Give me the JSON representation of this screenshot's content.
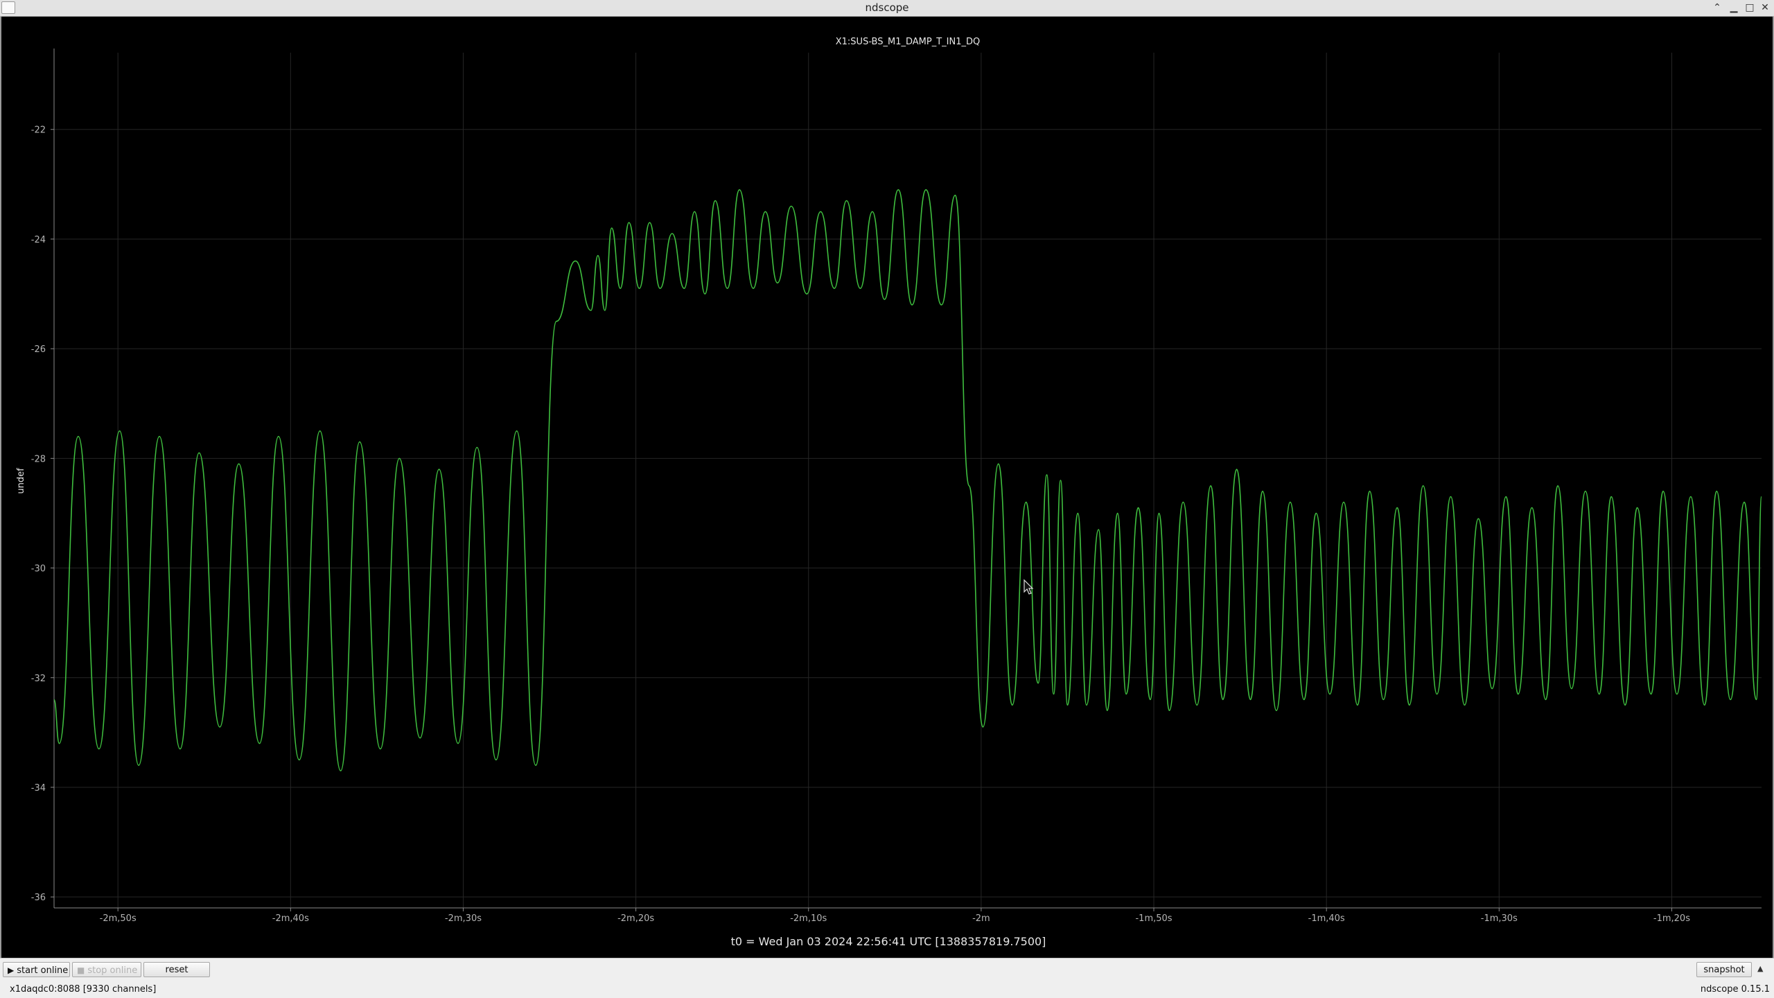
{
  "window": {
    "title": "ndscope"
  },
  "plot": {
    "channel": "X1:SUS-BS_M1_DAMP_T_IN1_DQ",
    "y_label": "undef",
    "t0_label": "t0 = Wed Jan 03 2024 22:56:41 UTC [1388357819.7500]",
    "trace_color": "#3fbf3f"
  },
  "chart_data": {
    "type": "line",
    "title": "X1:SUS-BS_M1_DAMP_T_IN1_DQ",
    "ylabel": "undef",
    "xlabel": "t0 = Wed Jan 03 2024 22:56:41 UTC [1388357819.7500]",
    "x_unit": "seconds relative to t0",
    "xlim": [
      -173.7,
      -74.8
    ],
    "ylim": [
      -36.2,
      -20.6
    ],
    "x_ticks": [
      {
        "value": -170,
        "label": "-2m,50s"
      },
      {
        "value": -160,
        "label": "-2m,40s"
      },
      {
        "value": -150,
        "label": "-2m,30s"
      },
      {
        "value": -140,
        "label": "-2m,20s"
      },
      {
        "value": -130,
        "label": "-2m,10s"
      },
      {
        "value": -120,
        "label": "-2m"
      },
      {
        "value": -110,
        "label": "-1m,50s"
      },
      {
        "value": -100,
        "label": "-1m,40s"
      },
      {
        "value": -90,
        "label": "-1m,30s"
      },
      {
        "value": -80,
        "label": "-1m,20s"
      }
    ],
    "y_ticks": [
      {
        "value": -22,
        "label": "-22"
      },
      {
        "value": -24,
        "label": "-24"
      },
      {
        "value": -26,
        "label": "-26"
      },
      {
        "value": -28,
        "label": "-28"
      },
      {
        "value": -30,
        "label": "-30"
      },
      {
        "value": -32,
        "label": "-32"
      },
      {
        "value": -34,
        "label": "-34"
      },
      {
        "value": -36,
        "label": "-36"
      }
    ],
    "grid": true,
    "series": [
      {
        "color": "#3fbf3f",
        "x": [
          -173.7,
          -173.4,
          -172.3,
          -171.1,
          -169.9,
          -168.8,
          -167.6,
          -166.4,
          -165.3,
          -164.1,
          -163.0,
          -161.8,
          -160.7,
          -159.5,
          -158.3,
          -157.1,
          -156.0,
          -154.8,
          -153.7,
          -152.5,
          -151.4,
          -150.3,
          -149.2,
          -148.1,
          -146.9,
          -145.8,
          -144.6,
          -143.5,
          -142.6,
          -142.2,
          -141.8,
          -141.4,
          -140.9,
          -140.4,
          -139.8,
          -139.2,
          -138.6,
          -137.9,
          -137.2,
          -136.6,
          -136.0,
          -135.4,
          -134.7,
          -134.0,
          -133.2,
          -132.5,
          -131.8,
          -131.0,
          -130.1,
          -129.3,
          -128.5,
          -127.8,
          -127.0,
          -126.3,
          -125.6,
          -124.8,
          -124.0,
          -123.2,
          -122.3,
          -121.5,
          -120.7,
          -119.9,
          -119.0,
          -118.2,
          -117.4,
          -116.7,
          -116.2,
          -115.8,
          -115.4,
          -115.0,
          -114.4,
          -113.9,
          -113.2,
          -112.7,
          -112.1,
          -111.6,
          -110.9,
          -110.2,
          -109.7,
          -109.1,
          -108.3,
          -107.5,
          -106.7,
          -106.0,
          -105.2,
          -104.4,
          -103.7,
          -102.9,
          -102.1,
          -101.3,
          -100.6,
          -99.8,
          -99.0,
          -98.2,
          -97.5,
          -96.7,
          -95.9,
          -95.2,
          -94.4,
          -93.6,
          -92.8,
          -92.0,
          -91.2,
          -90.4,
          -89.6,
          -88.9,
          -88.1,
          -87.3,
          -86.6,
          -85.8,
          -85.0,
          -84.2,
          -83.5,
          -82.7,
          -82.0,
          -81.2,
          -80.5,
          -79.7,
          -78.9,
          -78.1,
          -77.4,
          -76.6,
          -75.8,
          -75.1,
          -74.8
        ],
        "y": [
          -32.4,
          -33.2,
          -27.6,
          -33.3,
          -27.5,
          -33.6,
          -27.6,
          -33.3,
          -27.9,
          -32.9,
          -28.1,
          -33.2,
          -27.6,
          -33.5,
          -27.5,
          -33.7,
          -27.7,
          -33.3,
          -28.0,
          -33.1,
          -28.2,
          -33.2,
          -27.8,
          -33.5,
          -27.5,
          -33.6,
          -25.5,
          -24.4,
          -25.3,
          -24.3,
          -25.3,
          -23.8,
          -24.9,
          -23.7,
          -24.9,
          -23.7,
          -24.9,
          -23.9,
          -24.9,
          -23.5,
          -25.0,
          -23.3,
          -24.9,
          -23.1,
          -24.9,
          -23.5,
          -24.8,
          -23.4,
          -25.0,
          -23.5,
          -24.9,
          -23.3,
          -24.9,
          -23.5,
          -25.1,
          -23.1,
          -25.2,
          -23.1,
          -25.2,
          -23.2,
          -28.5,
          -32.9,
          -28.1,
          -32.5,
          -28.8,
          -32.1,
          -28.3,
          -32.3,
          -28.4,
          -32.5,
          -29.0,
          -32.5,
          -29.3,
          -32.6,
          -29.0,
          -32.3,
          -28.9,
          -32.4,
          -29.0,
          -32.6,
          -28.8,
          -32.5,
          -28.5,
          -32.4,
          -28.2,
          -32.4,
          -28.6,
          -32.6,
          -28.8,
          -32.4,
          -29.0,
          -32.3,
          -28.8,
          -32.5,
          -28.6,
          -32.4,
          -28.9,
          -32.5,
          -28.5,
          -32.3,
          -28.7,
          -32.5,
          -29.1,
          -32.2,
          -28.7,
          -32.3,
          -28.9,
          -32.4,
          -28.5,
          -32.2,
          -28.6,
          -32.3,
          -28.7,
          -32.5,
          -28.9,
          -32.3,
          -28.6,
          -32.3,
          -28.7,
          -32.5,
          -28.6,
          -32.4,
          -28.8,
          -32.4,
          -28.7
        ]
      }
    ]
  },
  "toolbar": {
    "start_label": "start online",
    "stop_label": "stop online",
    "reset_label": "reset",
    "snapshot_label": "snapshot"
  },
  "status": {
    "server": "x1daqdc0:8088  [9330 channels]",
    "version": "ndscope 0.15.1"
  }
}
